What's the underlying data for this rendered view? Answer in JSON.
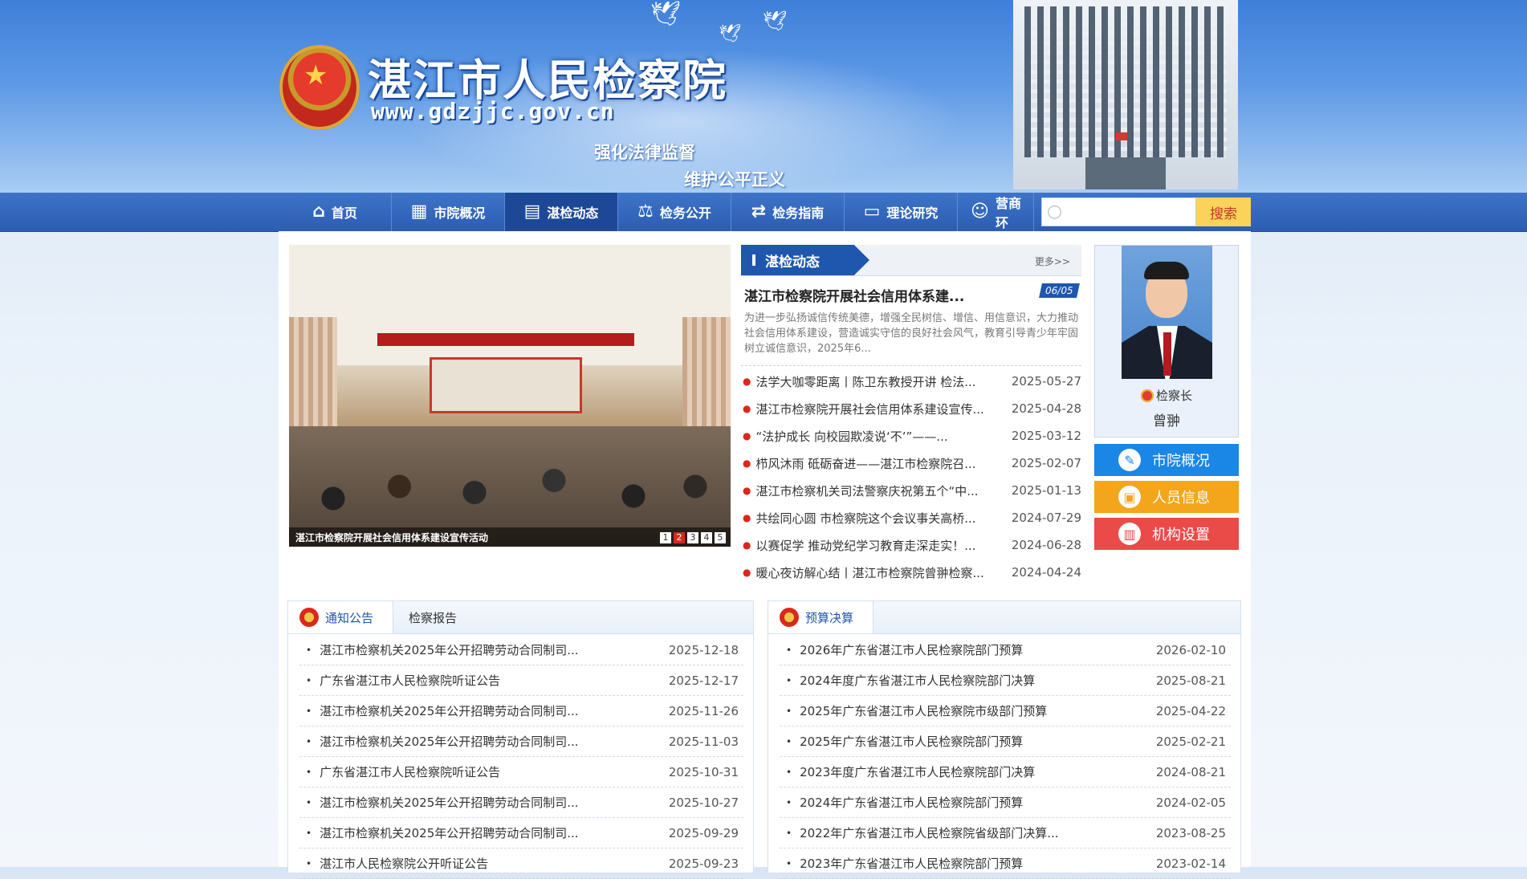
{
  "header": {
    "site_title": "湛江市人民检察院",
    "site_url": "www.gdzjjc.gov.cn",
    "slogan_1": "强化法律监督",
    "slogan_2": "维护公平正义"
  },
  "nav": {
    "items": [
      {
        "label": "首页",
        "icon": "home-icon"
      },
      {
        "label": "市院概况",
        "icon": "building-icon"
      },
      {
        "label": "湛检动态",
        "icon": "news-icon"
      },
      {
        "label": "检务公开",
        "icon": "scales-icon"
      },
      {
        "label": "检务指南",
        "icon": "guide-icon"
      },
      {
        "label": "理论研究",
        "icon": "book-icon"
      },
      {
        "label": "营商环",
        "icon": "person-icon"
      }
    ],
    "active_index": 2,
    "search_placeholder": "",
    "search_button": "搜索"
  },
  "carousel": {
    "caption": "湛江市检察院开展社会信用体系建设宣传活动",
    "pages": [
      "1",
      "2",
      "3",
      "4",
      "5"
    ],
    "active_page": 1
  },
  "news": {
    "tab_label": "湛检动态",
    "more_label": "更多>>",
    "headline": "湛江市检察院开展社会信用体系建...",
    "headline_date": "06/05",
    "summary": "为进一步弘扬诚信传统美德，增强全民树信、增信、用信意识，大力推动社会信用体系建设，营造诚实守信的良好社会风气，教育引导青少年牢固树立诚信意识，2025年6...",
    "items": [
      {
        "title": "法学大咖零距离丨陈卫东教授开讲 检法...",
        "date": "2025-05-27"
      },
      {
        "title": "湛江市检察院开展社会信用体系建设宣传...",
        "date": "2025-04-28"
      },
      {
        "title": "“法护成长 向校园欺凌说‘不’”——...",
        "date": "2025-03-12"
      },
      {
        "title": "栉风沐雨 砥砺奋进——湛江市检察院召...",
        "date": "2025-02-07"
      },
      {
        "title": "湛江市检察机关司法警察庆祝第五个“中...",
        "date": "2025-01-13"
      },
      {
        "title": "共绘同心圆 市检察院这个会议事关高桥...",
        "date": "2024-07-29"
      },
      {
        "title": "以赛促学 推动党纪学习教育走深走实！...",
        "date": "2024-06-28"
      },
      {
        "title": "暖心夜访解心结丨湛江市检察院曾翀检察...",
        "date": "2024-04-24"
      }
    ]
  },
  "sidebar": {
    "chief_role": "检察长",
    "chief_name": "曾翀",
    "buttons": [
      {
        "label": "市院概况",
        "icon": "pen-icon",
        "color": "#1a86e6"
      },
      {
        "label": "人员信息",
        "icon": "id-card-icon",
        "color": "#f3a51c"
      },
      {
        "label": "机构设置",
        "icon": "org-icon",
        "color": "#ea4a48"
      }
    ]
  },
  "notice_panel": {
    "tabs": [
      "通知公告",
      "检察报告"
    ],
    "active_tab": 0,
    "items": [
      {
        "title": "湛江市检察机关2025年公开招聘劳动合同制司...",
        "date": "2025-12-18"
      },
      {
        "title": "广东省湛江市人民检察院听证公告",
        "date": "2025-12-17"
      },
      {
        "title": "湛江市检察机关2025年公开招聘劳动合同制司...",
        "date": "2025-11-26"
      },
      {
        "title": "湛江市检察机关2025年公开招聘劳动合同制司...",
        "date": "2025-11-03"
      },
      {
        "title": "广东省湛江市人民检察院听证公告",
        "date": "2025-10-31"
      },
      {
        "title": "湛江市检察机关2025年公开招聘劳动合同制司...",
        "date": "2025-10-27"
      },
      {
        "title": "湛江市检察机关2025年公开招聘劳动合同制司...",
        "date": "2025-09-29"
      },
      {
        "title": "湛江市人民检察院公开听证公告",
        "date": "2025-09-23"
      }
    ]
  },
  "budget_panel": {
    "tabs": [
      "预算决算"
    ],
    "active_tab": 0,
    "items": [
      {
        "title": "2026年广东省湛江市人民检察院部门预算",
        "date": "2026-02-10"
      },
      {
        "title": "2024年度广东省湛江市人民检察院部门决算",
        "date": "2025-08-21"
      },
      {
        "title": "2025年广东省湛江市人民检察院市级部门预算",
        "date": "2025-04-22"
      },
      {
        "title": "2025年广东省湛江市人民检察院部门预算",
        "date": "2025-02-21"
      },
      {
        "title": "2023年度广东省湛江市人民检察院部门决算",
        "date": "2024-08-21"
      },
      {
        "title": "2024年广东省湛江市人民检察院部门预算",
        "date": "2024-02-05"
      },
      {
        "title": "2022年广东省湛江市人民检察院省级部门决算...",
        "date": "2023-08-25"
      },
      {
        "title": "2023年广东省湛江市人民检察院部门预算",
        "date": "2023-02-14"
      }
    ]
  }
}
